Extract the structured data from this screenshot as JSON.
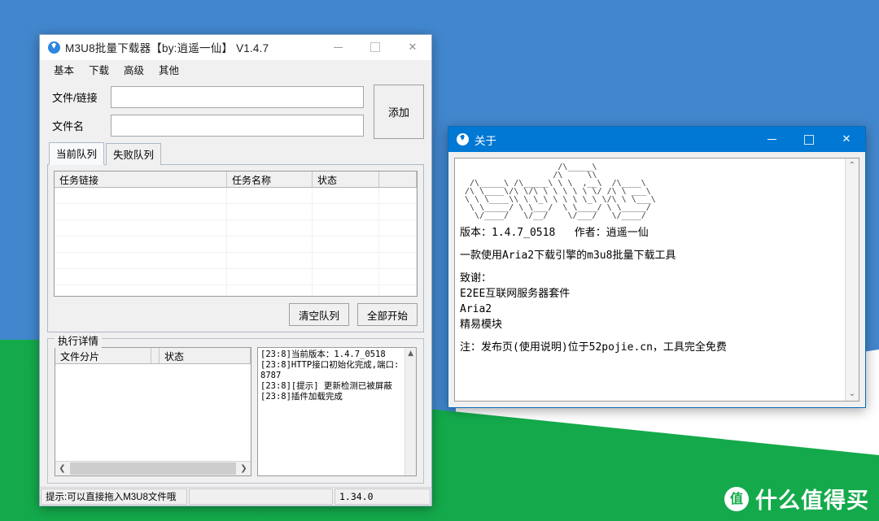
{
  "wallpaper": {
    "blue": "#4287ce",
    "green": "#14aa4b",
    "white": "#ffffff"
  },
  "watermark": {
    "badge_glyph": "值",
    "text": "什么值得买"
  },
  "main_window": {
    "title": "M3U8批量下载器【by:逍遥一仙】 V1.4.7",
    "icon": "download-circle-icon",
    "window_buttons": {
      "minimize": "—",
      "maximize": "▢",
      "close": "✕"
    },
    "menu": [
      {
        "label": "基本"
      },
      {
        "label": "下载"
      },
      {
        "label": "高级"
      },
      {
        "label": "其他"
      }
    ],
    "fields": [
      {
        "label": "文件/链接",
        "value": "",
        "placeholder": ""
      },
      {
        "label": "文件名",
        "value": "",
        "placeholder": ""
      }
    ],
    "add_button": "添加",
    "tabs": [
      {
        "label": "当前队列",
        "active": true
      },
      {
        "label": "失败队列",
        "active": false
      }
    ],
    "queue_table": {
      "columns": [
        "任务链接",
        "任务名称",
        "状态",
        ""
      ],
      "rows": []
    },
    "queue_buttons": [
      {
        "label": "清空队列"
      },
      {
        "label": "全部开始"
      }
    ],
    "detail_group": {
      "legend": "执行详情",
      "shard_table": {
        "columns": [
          "文件分片",
          "",
          "状态"
        ],
        "rows": []
      },
      "log_lines": [
        "[23:8]当前版本：1.4.7_0518",
        "[23:8]HTTP接口初始化完成,端口: 8787",
        "[23:8][提示] 更新检测已被屏蔽",
        "[23:8]插件加载完成"
      ]
    },
    "status_bar": {
      "hint": "提示:可以直接拖入M3U8文件哦",
      "middle": "",
      "version": "1.34.0"
    }
  },
  "about_window": {
    "title": "关于",
    "icon": "download-circle-icon",
    "window_buttons": {
      "minimize": "—",
      "maximize": "▢",
      "close": "✕"
    },
    "ascii_art": "                    /\\_____\\\n                   /\\     \\\\\n  /\\_____\\ /\\_____\\ \\ \\  ,__\\  /\\____\\\n /\\ \\____\\/\\ \\/\\ \\ \\ \\ \\ \\ \\/ /\\ \\ ___\\\n \\ \\ \\____\\\\ \\ \\_\\ \\ \\ \\ \\_\\ \\/\\ \\ \\___\\\n  \\ \\_____/ \\ \\___/  \\ \\____/ \\ \\_____/\n   \\/____/   \\/__/    \\/___/   \\/____/",
    "lines": [
      {
        "text": "版本：1.4.7_0518   作者：逍遥一仙",
        "gap_after": true
      },
      {
        "text": "一款使用Aria2下载引擎的m3u8批量下载工具",
        "gap_after": true
      },
      {
        "text": "致谢：",
        "gap_after": false
      },
      {
        "text": "E2EE互联网服务器套件",
        "gap_after": false
      },
      {
        "text": "Aria2",
        "gap_after": false
      },
      {
        "text": "精易模块",
        "gap_after": true
      },
      {
        "text": "注：发布页(使用说明)位于52pojie.cn，工具完全免费",
        "gap_after": false
      }
    ],
    "scroll": {
      "up": "⌃",
      "down": "⌄"
    }
  }
}
